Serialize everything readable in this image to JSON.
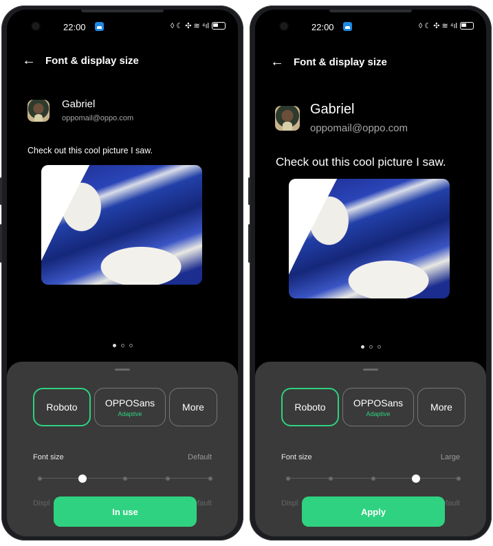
{
  "status_bar": {
    "time": "22:00",
    "icons": "◊ ☾ ✣ ≋ ⁴ıl"
  },
  "header": {
    "back_icon": "←",
    "title": "Font & display size"
  },
  "message": {
    "sender": "Gabriel",
    "email": "oppomail@oppo.com",
    "text": "Check out this cool picture I saw."
  },
  "font_options": [
    {
      "label": "Roboto",
      "sub": ""
    },
    {
      "label": "OPPOSans",
      "sub": "Adaptive"
    },
    {
      "label": "More",
      "sub": ""
    }
  ],
  "font_size_label": "Font size",
  "display_size_label_partial": "Displ",
  "display_size_value_partial": "efault",
  "accent_color": "#2fd280",
  "left_panel": {
    "font_size_value": "Default",
    "slider_level": 1,
    "action_label": "In use"
  },
  "right_panel": {
    "font_size_value": "Large",
    "slider_level": 3,
    "action_label": "Apply"
  }
}
